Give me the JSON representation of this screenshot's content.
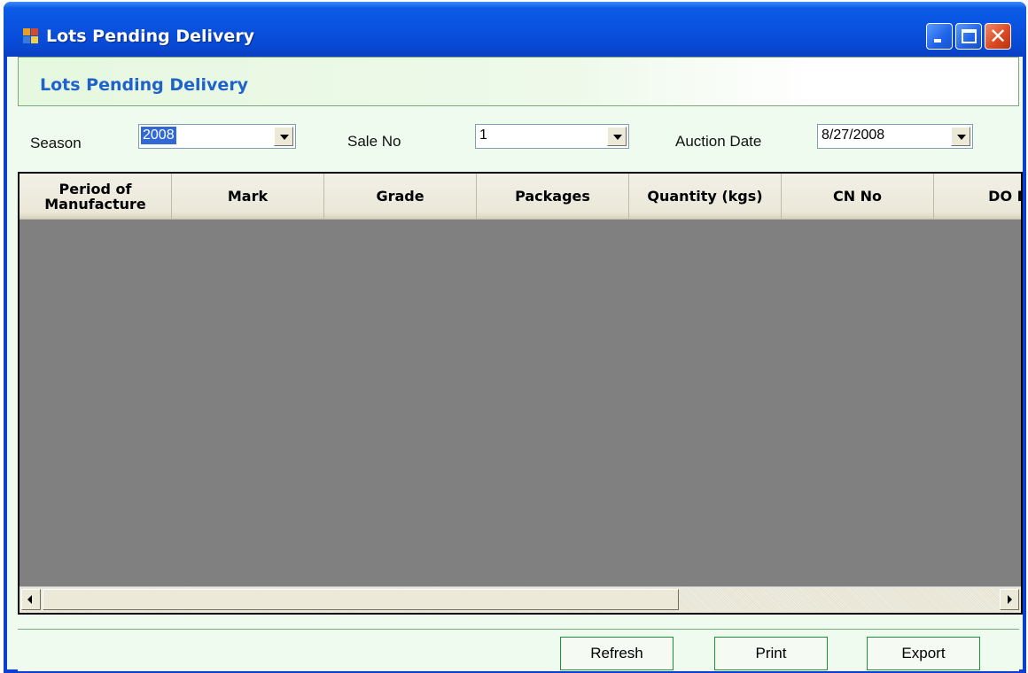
{
  "window": {
    "title": "Lots Pending Delivery"
  },
  "banner": {
    "title": "Lots Pending Delivery"
  },
  "filters": {
    "season_label": "Season",
    "season_value": "2008",
    "sale_no_label": "Sale No",
    "sale_no_value": "1",
    "auction_date_label": "Auction Date",
    "auction_date_value": "8/27/2008"
  },
  "grid": {
    "columns": [
      "Period of Manufacture",
      "Mark",
      "Grade",
      "Packages",
      "Quantity (kgs)",
      "CN No",
      "DO N"
    ],
    "rows": []
  },
  "buttons": {
    "refresh": "Refresh",
    "print": "Print",
    "export": "Export"
  },
  "colors": {
    "titlebar": "#0a52e0",
    "banner_text": "#1f62c9",
    "grid_background": "#808080",
    "button_border": "#1f8f3a"
  }
}
